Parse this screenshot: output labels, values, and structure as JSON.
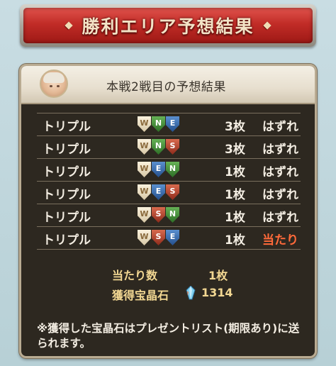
{
  "banner": {
    "title": "勝利エリア予想結果"
  },
  "panel": {
    "title": "本戦2戦目の予想結果",
    "rows": [
      {
        "label": "トリプル",
        "shields": [
          "W",
          "N",
          "E"
        ],
        "count": "3枚",
        "result": "はずれ",
        "win": false
      },
      {
        "label": "トリプル",
        "shields": [
          "W",
          "N",
          "S"
        ],
        "count": "3枚",
        "result": "はずれ",
        "win": false
      },
      {
        "label": "トリプル",
        "shields": [
          "W",
          "E",
          "N"
        ],
        "count": "1枚",
        "result": "はずれ",
        "win": false
      },
      {
        "label": "トリプル",
        "shields": [
          "W",
          "E",
          "S"
        ],
        "count": "1枚",
        "result": "はずれ",
        "win": false
      },
      {
        "label": "トリプル",
        "shields": [
          "W",
          "S",
          "N"
        ],
        "count": "1枚",
        "result": "はずれ",
        "win": false
      },
      {
        "label": "トリプル",
        "shields": [
          "W",
          "S",
          "E"
        ],
        "count": "1枚",
        "result": "当たり",
        "win": true
      }
    ],
    "summary": {
      "hits_label": "当たり数",
      "hits_value": "1枚",
      "crystals_label": "獲得宝晶石",
      "crystals_value": "1314"
    },
    "note": "※獲得した宝晶石はプレゼントリスト(期限あり)に送られます。"
  },
  "colors": {
    "win": "#ff6a3a",
    "text": "#f3ede2",
    "summary": "#f2d792",
    "W": "#fbf2dd",
    "N": "#2d6e26",
    "E": "#244f8c",
    "S": "#8e2a1a"
  },
  "icons": {
    "avatar": "character-portrait",
    "crystal": "crystal-icon"
  }
}
